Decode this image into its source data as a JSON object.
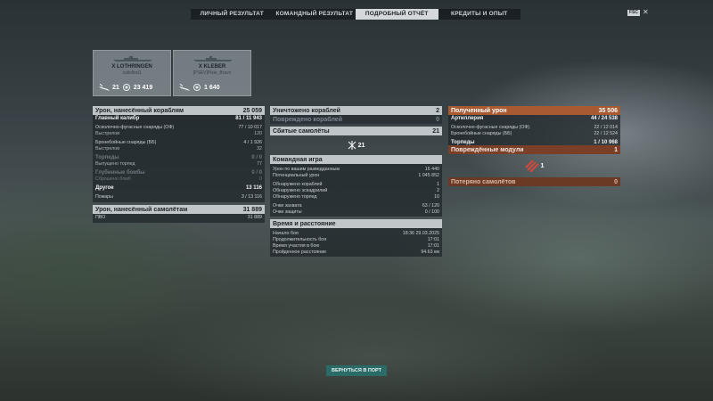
{
  "tabs": [
    {
      "label": "ЛИЧНЫЙ РЕЗУЛЬТАТ"
    },
    {
      "label": "КОМАНДНЫЙ РЕЗУЛЬТАТ"
    },
    {
      "label": "ПОДРОБНЫЙ ОТЧЁТ"
    },
    {
      "label": "КРЕДИТЫ И ОПЫТ"
    }
  ],
  "active_tab": 2,
  "top_badge": "FSC",
  "ships": [
    {
      "tier": "X",
      "name": "LOTHRINGEN",
      "player": "satisfied1",
      "kills": "21",
      "xp": "23 419"
    },
    {
      "tier": "X",
      "name": "KLEBER",
      "player": "[PSEV]Pixie_Bravo",
      "kills": "",
      "xp": "1 640"
    }
  ],
  "left": {
    "damage_ships": {
      "label": "Урон, нанесённый кораблям",
      "value": "25 059"
    },
    "main_battery": {
      "label": "Главный калибр",
      "value": "81 / 11 943"
    },
    "he": {
      "label": "Осколочно-фугасные снаряды (ОФ)",
      "value": "77 / 10 017"
    },
    "he_shots": {
      "label": "Выстрелов",
      "value": "120"
    },
    "ap": {
      "label": "Бронебойные снаряды (ББ)",
      "value": "4 / 1 926"
    },
    "ap_shots": {
      "label": "Выстрелов",
      "value": "32"
    },
    "torpedoes": {
      "label": "Торпеды",
      "value": "0 / 0"
    },
    "torp_launched": {
      "label": "Выпущено торпед",
      "value": "77"
    },
    "depth": {
      "label": "Глубинные бомбы",
      "value": "0 / 0"
    },
    "depth_dropped": {
      "label": "Сброшено бомб",
      "value": "0"
    },
    "other": {
      "label": "Другое",
      "value": "13 116"
    },
    "fires": {
      "label": "Пожары",
      "value": "3 / 13 116"
    },
    "damage_planes": {
      "label": "Урон, нанесённый самолётам",
      "value": "31 889"
    },
    "aa": {
      "label": "ПВО",
      "value": "31 889"
    }
  },
  "middle": {
    "destroyed": {
      "label": "Уничтожено кораблей",
      "value": "2"
    },
    "damaged": {
      "label": "Повреждено кораблей",
      "value": "0"
    },
    "planes_shot": {
      "label": "Сбитые самолёты",
      "value": "21"
    },
    "planes_icon_value": "21",
    "team_header": "Командная игра",
    "team_rows": [
      {
        "label": "Урон по вашим разведданным",
        "value": "16 440"
      },
      {
        "label": "Потенциальный урон",
        "value": "1 045 852"
      },
      {
        "label": "",
        "value": ""
      },
      {
        "label": "Обнаружено кораблей",
        "value": "1"
      },
      {
        "label": "Обнаружено эскадрилий",
        "value": "2"
      },
      {
        "label": "Обнаружено торпед",
        "value": "10"
      },
      {
        "label": "",
        "value": ""
      },
      {
        "label": "Очки захвата",
        "value": "63 / 120"
      },
      {
        "label": "Очки защиты",
        "value": "0 / 100"
      }
    ],
    "time_header": "Время и расстояние",
    "time_rows": [
      {
        "label": "Начало боя",
        "value": "18:36  29.03.2025"
      },
      {
        "label": "Продолжительность боя",
        "value": "17:01"
      },
      {
        "label": "Время участия в бою",
        "value": "17:01"
      },
      {
        "label": "Пройденное расстояние",
        "value": "94.63 км"
      }
    ]
  },
  "right": {
    "received": {
      "label": "Полученный урон",
      "value": "35 506"
    },
    "artillery": {
      "label": "Артиллерия",
      "value": "44 / 24 538"
    },
    "he": {
      "label": "Осколочно-фугасные снаряды (ОФ)",
      "value": "22 / 12 014"
    },
    "ap": {
      "label": "Бронебойные снаряды (ББ)",
      "value": "22 / 12 524"
    },
    "torpedoes": {
      "label": "Торпеды",
      "value": "1 / 10 968"
    },
    "modules": {
      "label": "Повреждённые модули",
      "value": "1"
    },
    "module_icon_value": "1",
    "planes_lost": {
      "label": "Потеряно самолётов",
      "value": "0"
    }
  },
  "back_button": "ВЕРНУТЬСЯ В ПОРТ",
  "colors": {
    "accent_orange": "#a85a33",
    "button_teal": "#2b6b67"
  }
}
